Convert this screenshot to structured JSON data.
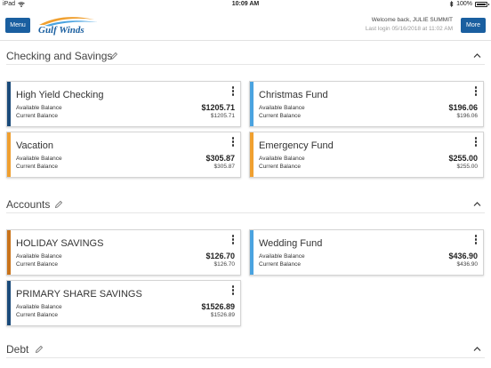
{
  "status_bar": {
    "carrier": "iPad",
    "time": "10:09 AM",
    "battery": "100%"
  },
  "header": {
    "menu_label": "Menu",
    "more_label": "More",
    "logo_text": "Gulf Winds",
    "welcome": "Welcome back,  JULIE SUMMIT",
    "last_login": "Last login 05/16/2018 at 11:02 AM"
  },
  "colors": {
    "primary": "#1a5fa0",
    "stripe_blue_dark": "#1a4a7a",
    "stripe_blue_light": "#4aa3e0",
    "stripe_orange": "#f0a030",
    "stripe_brown": "#c9731a"
  },
  "sections": [
    {
      "title": "Checking and Savings",
      "cards": [
        {
          "name": "High Yield Checking",
          "available_label": "Available Balance",
          "current_label": "Current Balance",
          "available": "$1205.71",
          "current": "$1205.71"
        },
        {
          "name": "Christmas Fund",
          "available_label": "Available Balance",
          "current_label": "Current Balance",
          "available": "$196.06",
          "current": "$196.06"
        },
        {
          "name": "Vacation",
          "available_label": "Available Balance",
          "current_label": "Current Balance",
          "available": "$305.87",
          "current": "$305.87"
        },
        {
          "name": "Emergency Fund",
          "available_label": "Available Balance",
          "current_label": "Current Balance",
          "available": "$255.00",
          "current": "$255.00"
        }
      ]
    },
    {
      "title": "Accounts",
      "cards": [
        {
          "name": "HOLIDAY SAVINGS",
          "available_label": "Available Balance",
          "current_label": "Current Balance",
          "available": "$126.70",
          "current": "$126.70"
        },
        {
          "name": "Wedding Fund",
          "available_label": "Available Balance",
          "current_label": "Current Balance",
          "available": "$436.90",
          "current": "$436.90"
        },
        {
          "name": "PRIMARY SHARE SAVINGS",
          "available_label": "Available Balance",
          "current_label": "Current Balance",
          "available": "$1526.89",
          "current": "$1526.89"
        }
      ]
    },
    {
      "title": "Debt",
      "cards": []
    }
  ]
}
